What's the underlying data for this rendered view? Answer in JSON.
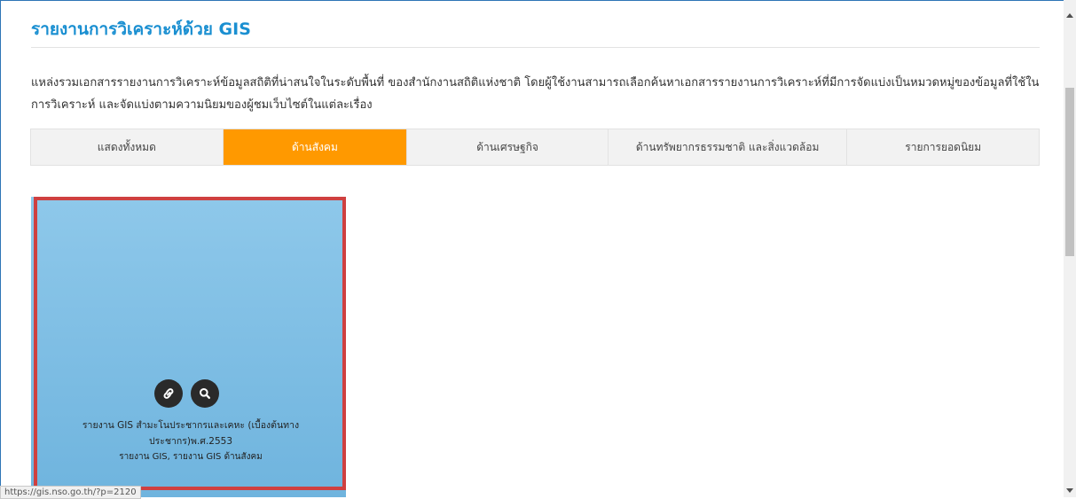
{
  "page": {
    "title": "รายงานการวิเคราะห์ด้วย GIS",
    "intro_line1": "แหล่งรวมเอกสารรายงานการวิเคราะห์ข้อมูลสถิติที่น่าสนใจในระดับพื้นที่ ของสำนักงานสถิติแห่งชาติ โดยผู้ใช้งานสามารถเลือกค้นหาเอกสารรายงานการวิเคราะห์ที่มีการจัดแบ่งเป็นหมวดหมู่ของข้อมูลที่ใช้ใน",
    "intro_line2": "การวิเคราะห์ และจัดแบ่งตามความนิยมของผู้ชมเว็บไซต์ในแต่ละเรื่อง"
  },
  "tabs": [
    {
      "label": "แสดงทั้งหมด",
      "active": false
    },
    {
      "label": "ด้านสังคม",
      "active": true
    },
    {
      "label": "ด้านเศรษฐกิจ",
      "active": false
    },
    {
      "label": "ด้านทรัพยากรธรรมชาติ และสิ่งแวดล้อม",
      "active": false
    },
    {
      "label": "รายการยอดนิยม",
      "active": false
    }
  ],
  "card": {
    "title_line1": "รายงาน GIS สำมะโนประชากรและเคหะ (เบื้องต้นทาง",
    "title_line2": "ประชากร)พ.ศ.2553",
    "categories": "รายงาน GIS, รายงาน GIS ด้านสังคม",
    "link_icon": "link-icon",
    "search_icon": "search-icon"
  },
  "status_bar": {
    "url": "https://gis.nso.go.th/?p=2120"
  },
  "colors": {
    "accent": "#1a8fd1",
    "active_tab": "#ff9900",
    "highlight": "#cf4040",
    "card_bg": "#7fbee4"
  }
}
